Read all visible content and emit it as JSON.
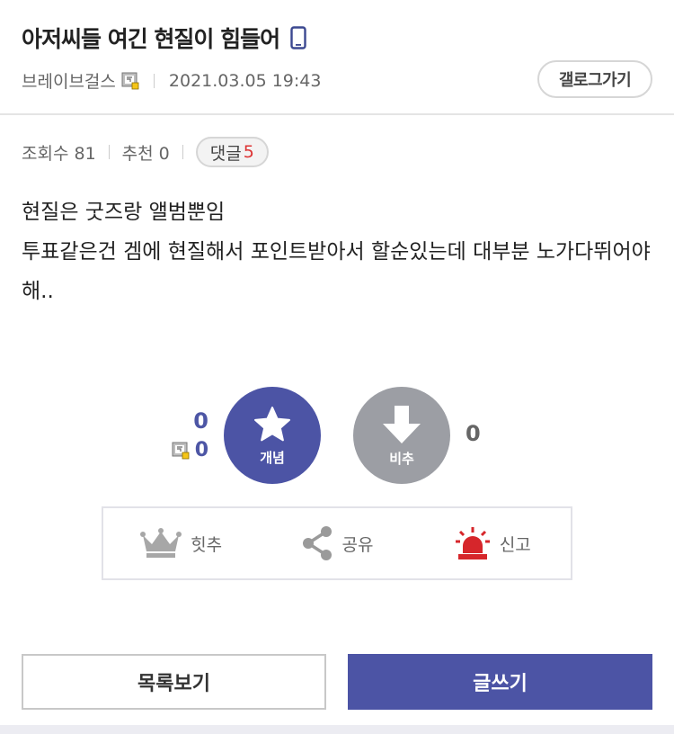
{
  "post": {
    "title": "아저씨들 여긴 현질이 힘들어",
    "author": "브레이브걸스",
    "datetime": "2021.03.05 19:43",
    "gallog_button": "갤로그가기"
  },
  "stats": {
    "views_label": "조회수 81",
    "recommend_label": "추천 0",
    "comment_label": "댓글",
    "comment_count": "5"
  },
  "content": {
    "lines": [
      "현질은 굿즈랑 앨범뿐임",
      "투표같은건 겜에 현질해서 포인트받아서 할순있는데 대부분 노가다뛰어야해.."
    ]
  },
  "vote": {
    "up_count": "0",
    "fix_count": "0",
    "up_label": "개념",
    "down_label": "비추",
    "down_count": "0",
    "colors": {
      "up": "#4c54a5",
      "down": "#9c9ea4"
    }
  },
  "actions": {
    "best_label": "힛추",
    "share_label": "공유",
    "report_label": "신고"
  },
  "buttons": {
    "list_label": "목록보기",
    "write_label": "글쓰기"
  }
}
